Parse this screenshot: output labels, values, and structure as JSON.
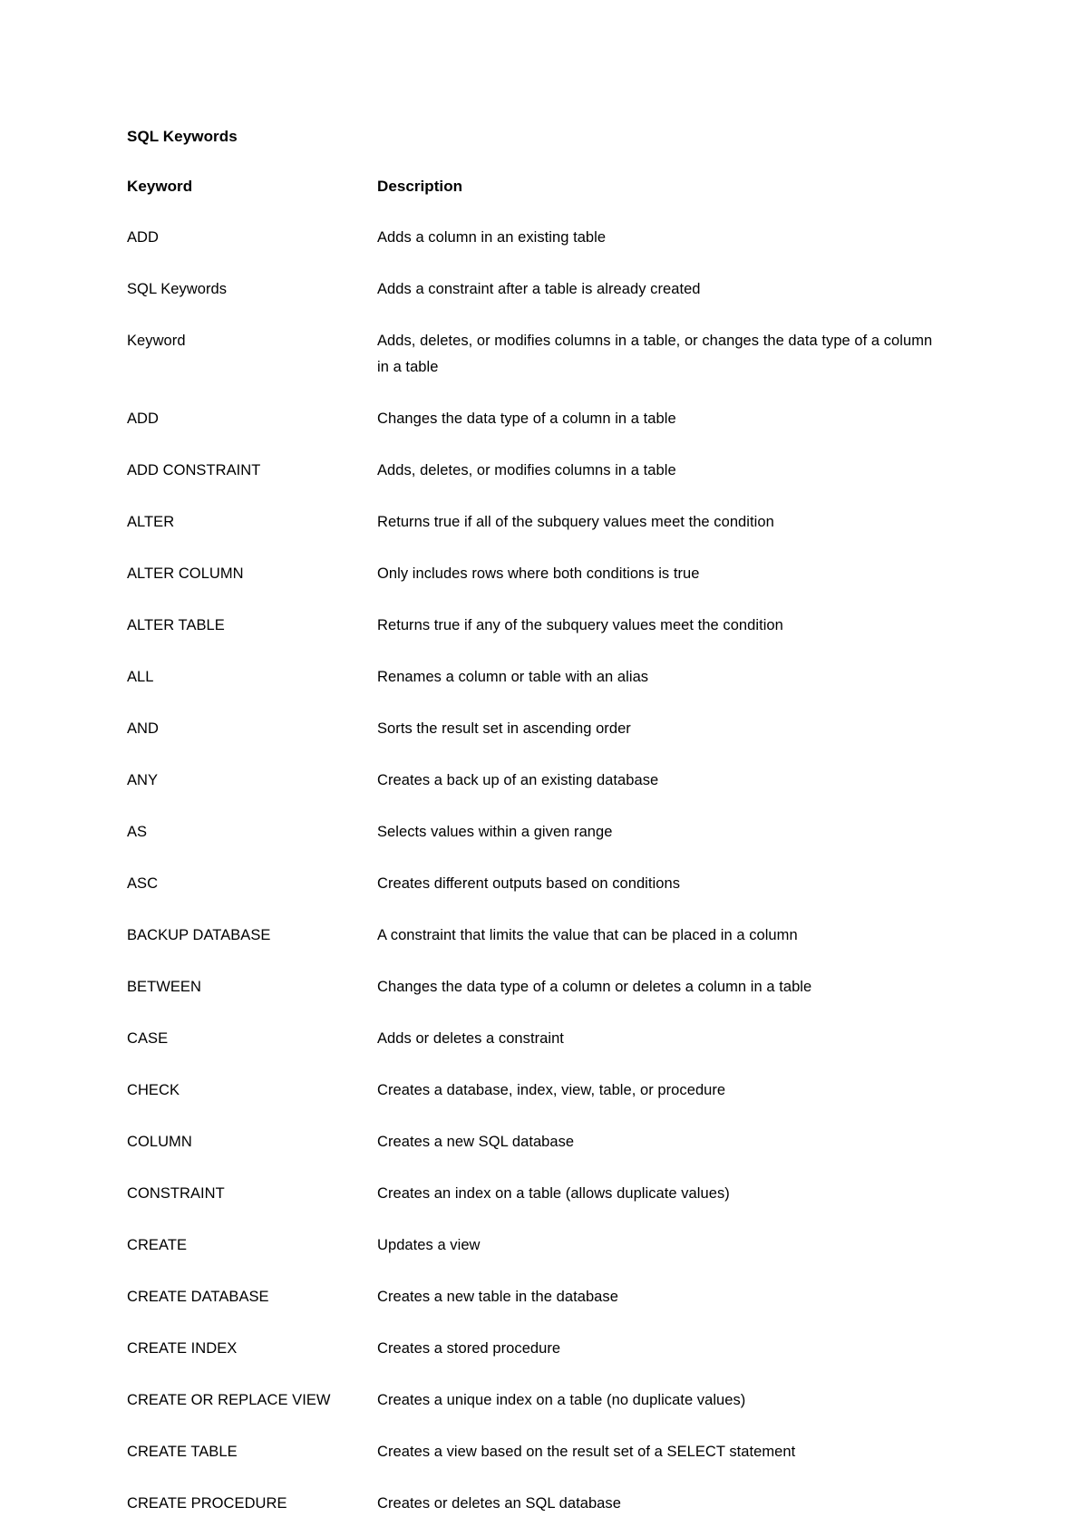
{
  "document": {
    "title": "SQL Keywords",
    "columns": {
      "keyword": "Keyword",
      "description": "Description"
    },
    "rows": [
      {
        "keyword": "ADD",
        "description": "Adds a column in an existing table"
      },
      {
        "keyword": "SQL Keywords",
        "description": "Adds a constraint after a table is already created"
      },
      {
        "keyword": "Keyword",
        "description": "Adds, deletes, or modifies columns in a table, or changes the data type of a column in a table"
      },
      {
        "keyword": "ADD",
        "description": "Changes the data type of a column in a table"
      },
      {
        "keyword": "ADD CONSTRAINT",
        "description": "Adds, deletes, or modifies columns in a table"
      },
      {
        "keyword": "ALTER",
        "description": "Returns true if all of the subquery values meet the condition"
      },
      {
        "keyword": "ALTER COLUMN",
        "description": "Only includes rows where both conditions is true"
      },
      {
        "keyword": "ALTER TABLE",
        "description": "Returns true if any of the subquery values meet the condition"
      },
      {
        "keyword": "ALL",
        "description": "Renames a column or table with an alias"
      },
      {
        "keyword": "AND",
        "description": "Sorts the result set in ascending order"
      },
      {
        "keyword": "ANY",
        "description": "Creates a back up of an existing database"
      },
      {
        "keyword": "AS",
        "description": "Selects values within a given range"
      },
      {
        "keyword": "ASC",
        "description": "Creates different outputs based on conditions"
      },
      {
        "keyword": "BACKUP DATABASE",
        "description": "A constraint that limits the value that can be placed in a column"
      },
      {
        "keyword": "BETWEEN",
        "description": "Changes the data type of a column or deletes a column in a table"
      },
      {
        "keyword": "CASE",
        "description": "Adds or deletes a constraint"
      },
      {
        "keyword": "CHECK",
        "description": "Creates a database, index, view, table, or procedure"
      },
      {
        "keyword": "COLUMN",
        "description": "Creates a new SQL database"
      },
      {
        "keyword": "CONSTRAINT",
        "description": "Creates an index on a table (allows duplicate values)"
      },
      {
        "keyword": "CREATE",
        "description": "Updates a view"
      },
      {
        "keyword": "CREATE DATABASE",
        "description": "Creates a new table in the database"
      },
      {
        "keyword": "CREATE INDEX",
        "description": "Creates a stored procedure"
      },
      {
        "keyword": "CREATE OR REPLACE VIEW",
        "description": "Creates a unique index on a table (no duplicate values)"
      },
      {
        "keyword": "CREATE TABLE",
        "description": "Creates a view based on the result set of a SELECT statement"
      },
      {
        "keyword": "CREATE PROCEDURE",
        "description": "Creates or deletes an SQL database"
      }
    ]
  }
}
